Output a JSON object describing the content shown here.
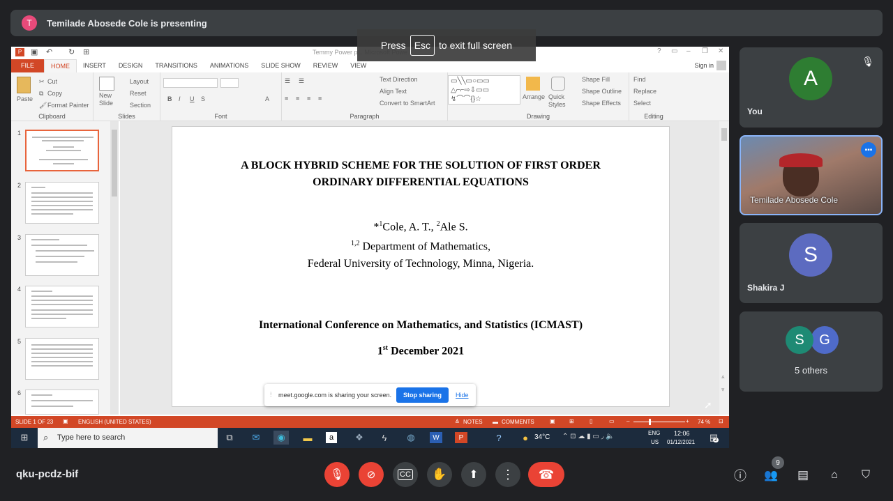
{
  "meet": {
    "presenter_initial": "T",
    "presenter_banner": "Temilade Abosede Cole is presenting",
    "esc_press": "Press",
    "esc_key": "Esc",
    "esc_rest": "to exit full screen",
    "meeting_code": "qku-pcdz-bif",
    "people_count": "9"
  },
  "participants": {
    "you_initial": "A",
    "you_label": "You",
    "presenter_name": "Temilade Abosede Cole",
    "shakira_initial": "S",
    "shakira_name": "Shakira J",
    "others_s": "S",
    "others_g": "G",
    "others_label": "5 others"
  },
  "ppt": {
    "window_title": "Temmy Power p... Microsoft Powe...",
    "sign_in": "Sign in",
    "tabs": [
      "FILE",
      "HOME",
      "INSERT",
      "DESIGN",
      "TRANSITIONS",
      "ANIMATIONS",
      "SLIDE SHOW",
      "REVIEW",
      "VIEW"
    ],
    "ribbon": {
      "paste": "Paste",
      "cut": "Cut",
      "copy": "Copy",
      "format_painter": "Format Painter",
      "clipboard": "Clipboard",
      "new_slide": "New Slide",
      "layout": "Layout",
      "reset": "Reset",
      "section": "Section",
      "slides": "Slides",
      "font": "Font",
      "paragraph": "Paragraph",
      "text_direction": "Text Direction",
      "align_text": "Align Text",
      "convert_smartart": "Convert to SmartArt",
      "arrange": "Arrange",
      "quick_styles": "Quick Styles",
      "shape_fill": "Shape Fill",
      "shape_outline": "Shape Outline",
      "shape_effects": "Shape Effects",
      "drawing": "Drawing",
      "find": "Find",
      "replace": "Replace",
      "select": "Select",
      "editing": "Editing"
    },
    "thumb_numbers": [
      "1",
      "2",
      "3",
      "4",
      "5",
      "6"
    ],
    "slide": {
      "title_line1": "A BLOCK HYBRID SCHEME FOR THE SOLUTION OF FIRST ORDER",
      "title_line2": "ORDINARY DIFFERENTIAL EQUATIONS",
      "authors_star": "*",
      "sup1": "1",
      "author1": "Cole, A. T., ",
      "sup2": "2",
      "author2": "Ale S.",
      "sup12": "1,2",
      "dept": " Department of Mathematics,",
      "univ": "Federal University of Technology, Minna, Nigeria.",
      "conference": "International Conference on Mathematics, and Statistics (ICMAST)",
      "date_day": "1",
      "date_sup": "st",
      "date_rest": " December 2021"
    },
    "share": {
      "message": "meet.google.com is sharing your screen.",
      "stop": "Stop sharing",
      "hide": "Hide"
    },
    "status": {
      "slide_of": "SLIDE 1 OF 23",
      "language": "ENGLISH (UNITED STATES)",
      "notes": "NOTES",
      "comments": "COMMENTS",
      "zoom": "74 %"
    }
  },
  "taskbar": {
    "search_placeholder": "Type here to search",
    "temperature": "34°C",
    "lang1": "ENG",
    "lang2": "US",
    "time": "12:06",
    "date": "01/12/2021",
    "notif_count": "2"
  },
  "colors": {
    "ppt_accent": "#d24726",
    "meet_bg": "#202124",
    "tile_bg": "#3c4043",
    "end_call": "#ea4335",
    "stop_blue": "#1a73e8"
  }
}
